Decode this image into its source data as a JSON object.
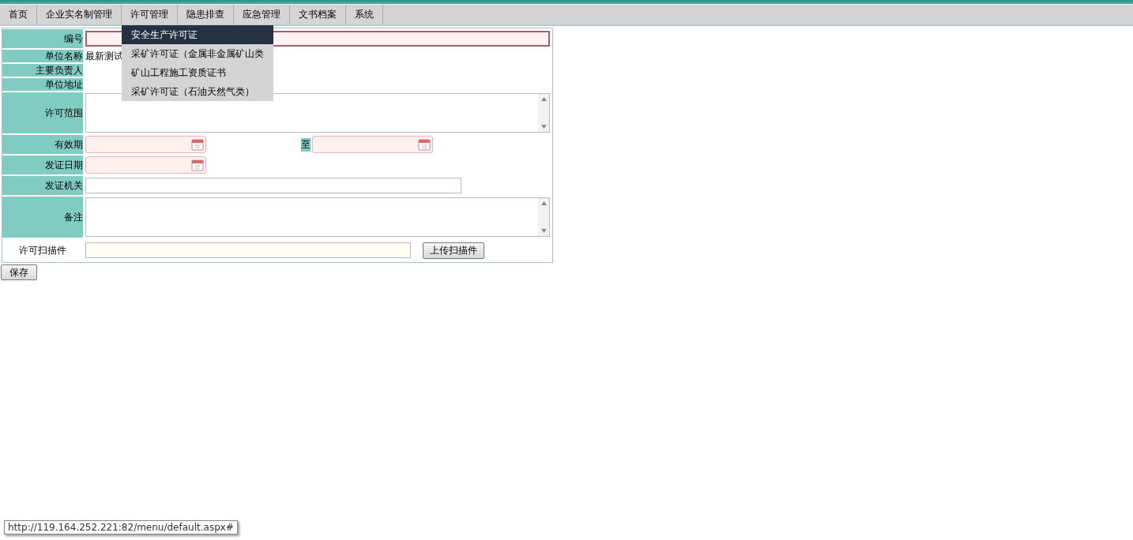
{
  "menu": [
    {
      "label": "首页"
    },
    {
      "label": "企业实名制管理"
    },
    {
      "label": "许可管理",
      "submenu": [
        {
          "label": "安全生产许可证",
          "selected": true
        },
        {
          "label": "采矿许可证（金属非金属矿山类",
          "selected": false
        },
        {
          "label": "矿山工程施工资质证书",
          "selected": false
        },
        {
          "label": "采矿许可证（石油天然气类）",
          "selected": false
        }
      ]
    },
    {
      "label": "隐患排查"
    },
    {
      "label": "应急管理"
    },
    {
      "label": "文书档案"
    },
    {
      "label": "系统"
    }
  ],
  "form": {
    "rows": [
      {
        "label": "编号",
        "kind": "text",
        "required": true,
        "focused": true
      },
      {
        "label": "单位名称",
        "kind": "static",
        "value": "最新测试"
      },
      {
        "label": "主要负责人",
        "kind": "static"
      },
      {
        "label": "单位地址",
        "kind": "static"
      },
      {
        "label": "许可范围",
        "kind": "textarea"
      },
      {
        "label": "有效期",
        "kind": "date_range",
        "required": true,
        "separator": "至"
      },
      {
        "label": "发证日期",
        "kind": "date",
        "required": true
      },
      {
        "label": "发证机关",
        "kind": "text",
        "required": false,
        "focused": false
      },
      {
        "label": "备注",
        "kind": "textarea"
      },
      {
        "label": "许可扫描件",
        "kind": "upload",
        "button": "上传扫描件"
      }
    ]
  },
  "save_button": "保存",
  "status_url": "http://119.164.252.221:82/menu/default.aspx#"
}
